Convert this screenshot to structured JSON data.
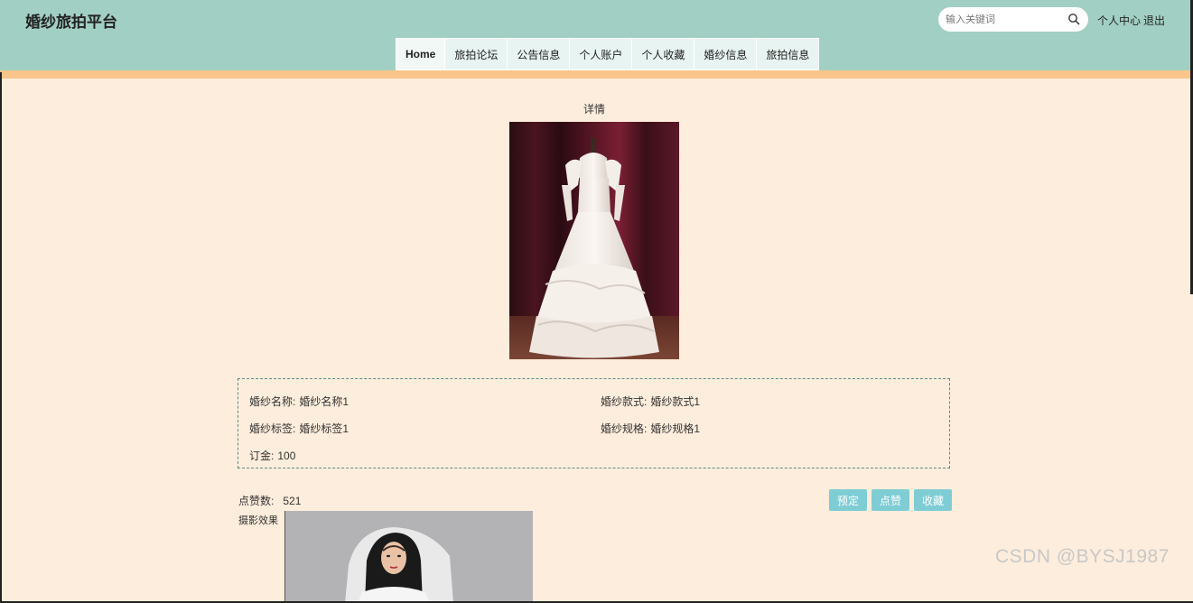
{
  "header": {
    "brand": "婚纱旅拍平台",
    "search_placeholder": "输入关键词",
    "user_center": "个人中心",
    "logout": "退出"
  },
  "nav": {
    "items": [
      "Home",
      "旅拍论坛",
      "公告信息",
      "个人账户",
      "个人收藏",
      "婚纱信息",
      "旅拍信息"
    ],
    "active": "Home"
  },
  "detail": {
    "title": "详情",
    "fields": {
      "name_label": "婚纱名称:",
      "name_value": "婚纱名称1",
      "style_label": "婚纱款式:",
      "style_value": "婚纱款式1",
      "tag_label": "婚纱标签:",
      "tag_value": "婚纱标签1",
      "spec_label": "婚纱规格:",
      "spec_value": "婚纱规格1",
      "deposit_label": "订金:",
      "deposit_value": "100"
    },
    "likes_label": "点赞数:",
    "likes_value": "521",
    "buttons": {
      "book": "预定",
      "like": "点赞",
      "favorite": "收藏"
    },
    "effect_label": "摄影效果"
  },
  "watermark": "CSDN @BYSJ1987",
  "colors": {
    "header_bg": "#a2cfc3",
    "stripe": "#f9c58a",
    "page_bg": "#fdeddc",
    "button": "#7fcdd4"
  }
}
